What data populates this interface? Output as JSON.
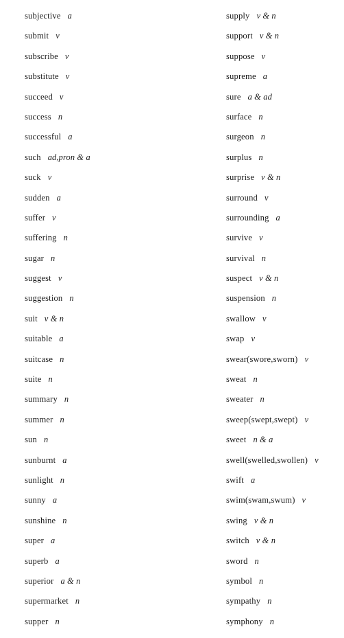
{
  "page": {
    "background_color": "#ffffff",
    "text_color": "#1c1c1c",
    "type": "vocabulary-word-list",
    "columns": 2
  },
  "left_column": {
    "entries": [
      {
        "word": "subjective",
        "pos": "a"
      },
      {
        "word": "submit",
        "pos": "v"
      },
      {
        "word": "subscribe",
        "pos": "v"
      },
      {
        "word": "substitute",
        "pos": "v"
      },
      {
        "word": "succeed",
        "pos": "v"
      },
      {
        "word": "success",
        "pos": "n"
      },
      {
        "word": "successful",
        "pos": "a"
      },
      {
        "word": "such",
        "pos": "ad,pron & a"
      },
      {
        "word": "suck",
        "pos": "v"
      },
      {
        "word": "sudden",
        "pos": "a"
      },
      {
        "word": "suffer",
        "pos": "v"
      },
      {
        "word": "suffering",
        "pos": "n"
      },
      {
        "word": "sugar",
        "pos": "n"
      },
      {
        "word": "suggest",
        "pos": "v"
      },
      {
        "word": "suggestion",
        "pos": "n"
      },
      {
        "word": "suit",
        "pos": "v & n"
      },
      {
        "word": "suitable",
        "pos": "a"
      },
      {
        "word": "suitcase",
        "pos": "n"
      },
      {
        "word": "suite",
        "pos": "n"
      },
      {
        "word": "summary",
        "pos": "n"
      },
      {
        "word": "summer",
        "pos": "n"
      },
      {
        "word": "sun",
        "pos": "n"
      },
      {
        "word": "sunburnt",
        "pos": "a"
      },
      {
        "word": "sunlight",
        "pos": "n"
      },
      {
        "word": "sunny",
        "pos": "a"
      },
      {
        "word": "sunshine",
        "pos": "n"
      },
      {
        "word": "super",
        "pos": "a"
      },
      {
        "word": "superb",
        "pos": "a"
      },
      {
        "word": "superior",
        "pos": "a & n"
      },
      {
        "word": "supermarket",
        "pos": "n"
      },
      {
        "word": "supper",
        "pos": "n"
      }
    ]
  },
  "right_column": {
    "entries": [
      {
        "word": "supply",
        "pos": "v & n"
      },
      {
        "word": "support",
        "pos": "v & n"
      },
      {
        "word": "suppose",
        "pos": "v"
      },
      {
        "word": "supreme",
        "pos": "a"
      },
      {
        "word": "sure",
        "pos": "a & ad"
      },
      {
        "word": "surface",
        "pos": "n"
      },
      {
        "word": "surgeon",
        "pos": "n"
      },
      {
        "word": "surplus",
        "pos": "n"
      },
      {
        "word": "surprise",
        "pos": "v & n"
      },
      {
        "word": "surround",
        "pos": "v"
      },
      {
        "word": "surrounding",
        "pos": "a"
      },
      {
        "word": "survive",
        "pos": "v"
      },
      {
        "word": "survival",
        "pos": "n"
      },
      {
        "word": "suspect",
        "pos": "v & n"
      },
      {
        "word": "suspension",
        "pos": "n"
      },
      {
        "word": "swallow",
        "pos": "v"
      },
      {
        "word": "swap",
        "pos": "v"
      },
      {
        "word": "swear(swore,sworn)",
        "pos": "v"
      },
      {
        "word": "sweat",
        "pos": "n"
      },
      {
        "word": "sweater",
        "pos": "n"
      },
      {
        "word": "sweep(swept,swept)",
        "pos": "v"
      },
      {
        "word": "sweet",
        "pos": "n & a"
      },
      {
        "word": "swell(swelled,swollen)",
        "pos": "v"
      },
      {
        "word": "swift",
        "pos": "a"
      },
      {
        "word": "swim(swam,swum)",
        "pos": "v"
      },
      {
        "word": "swing",
        "pos": "v & n"
      },
      {
        "word": "switch",
        "pos": "v & n"
      },
      {
        "word": "sword",
        "pos": "n"
      },
      {
        "word": "symbol",
        "pos": "n"
      },
      {
        "word": "sympathy",
        "pos": "n"
      },
      {
        "word": "symphony",
        "pos": "n"
      }
    ]
  }
}
